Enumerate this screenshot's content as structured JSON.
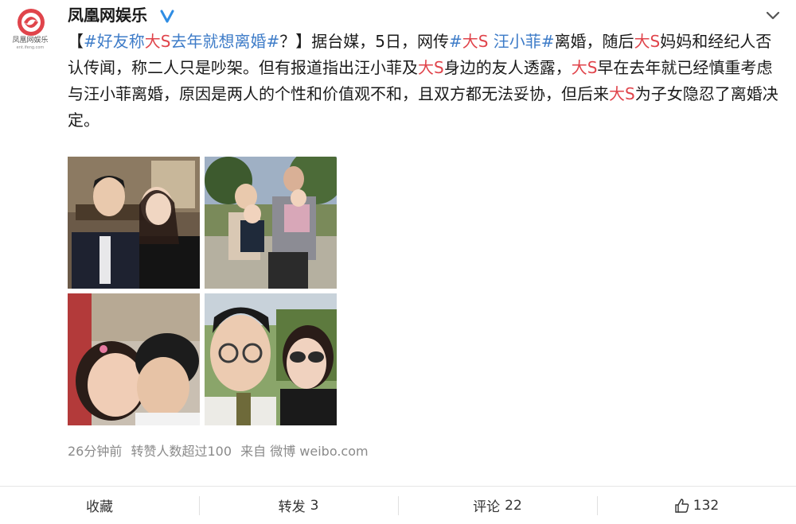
{
  "header": {
    "avatar_caption": "凤凰网娱乐",
    "avatar_sub": "ent.ifeng.com",
    "user_name": "凤凰网娱乐"
  },
  "post": {
    "segments": [
      {
        "text": "【",
        "style": "plain"
      },
      {
        "text": "#好友",
        "style": "tag"
      },
      {
        "text": "称",
        "style": "tag"
      },
      {
        "text": "大S",
        "style": "hl"
      },
      {
        "text": "去年就想离婚#",
        "style": "tag"
      },
      {
        "text": "？】据台媒，5日，网传",
        "style": "plain"
      },
      {
        "text": "#",
        "style": "tag"
      },
      {
        "text": "大S",
        "style": "hl"
      },
      {
        "text": " 汪小菲#",
        "style": "tag"
      },
      {
        "text": "离婚，随后",
        "style": "plain"
      },
      {
        "text": "大S",
        "style": "hl"
      },
      {
        "text": "妈妈和经纪人否认传闻，称二人只是吵架。但有报道指出汪小菲及",
        "style": "plain"
      },
      {
        "text": "大S",
        "style": "hl"
      },
      {
        "text": "身边的友人透露，",
        "style": "plain"
      },
      {
        "text": "大S",
        "style": "hl"
      },
      {
        "text": "早在去年就已经慎重考虑与汪小菲离婚，原因是两人的个性和价值观不和，且双方都无法妥协，但后来",
        "style": "plain"
      },
      {
        "text": "大S",
        "style": "hl"
      },
      {
        "text": "为子女隐忍了离婚决定。",
        "style": "plain"
      }
    ],
    "photos": [
      {
        "name": "photo-couple-formal"
      },
      {
        "name": "photo-family-outdoor"
      },
      {
        "name": "photo-kiss-selfie"
      },
      {
        "name": "photo-sunglasses-selfie"
      }
    ]
  },
  "meta": {
    "time": "26分钟前",
    "reposts_note": "转赞人数超过100",
    "source": "来自 微博 weibo.com"
  },
  "actions": {
    "favorite_label": "收藏",
    "repost_label": "转发",
    "repost_count": "3",
    "comment_label": "评论",
    "comment_count": "22",
    "like_count": "132"
  },
  "colors": {
    "tag": "#3e7cc8",
    "highlight": "#e0444b",
    "meta": "#8a8a8a"
  }
}
